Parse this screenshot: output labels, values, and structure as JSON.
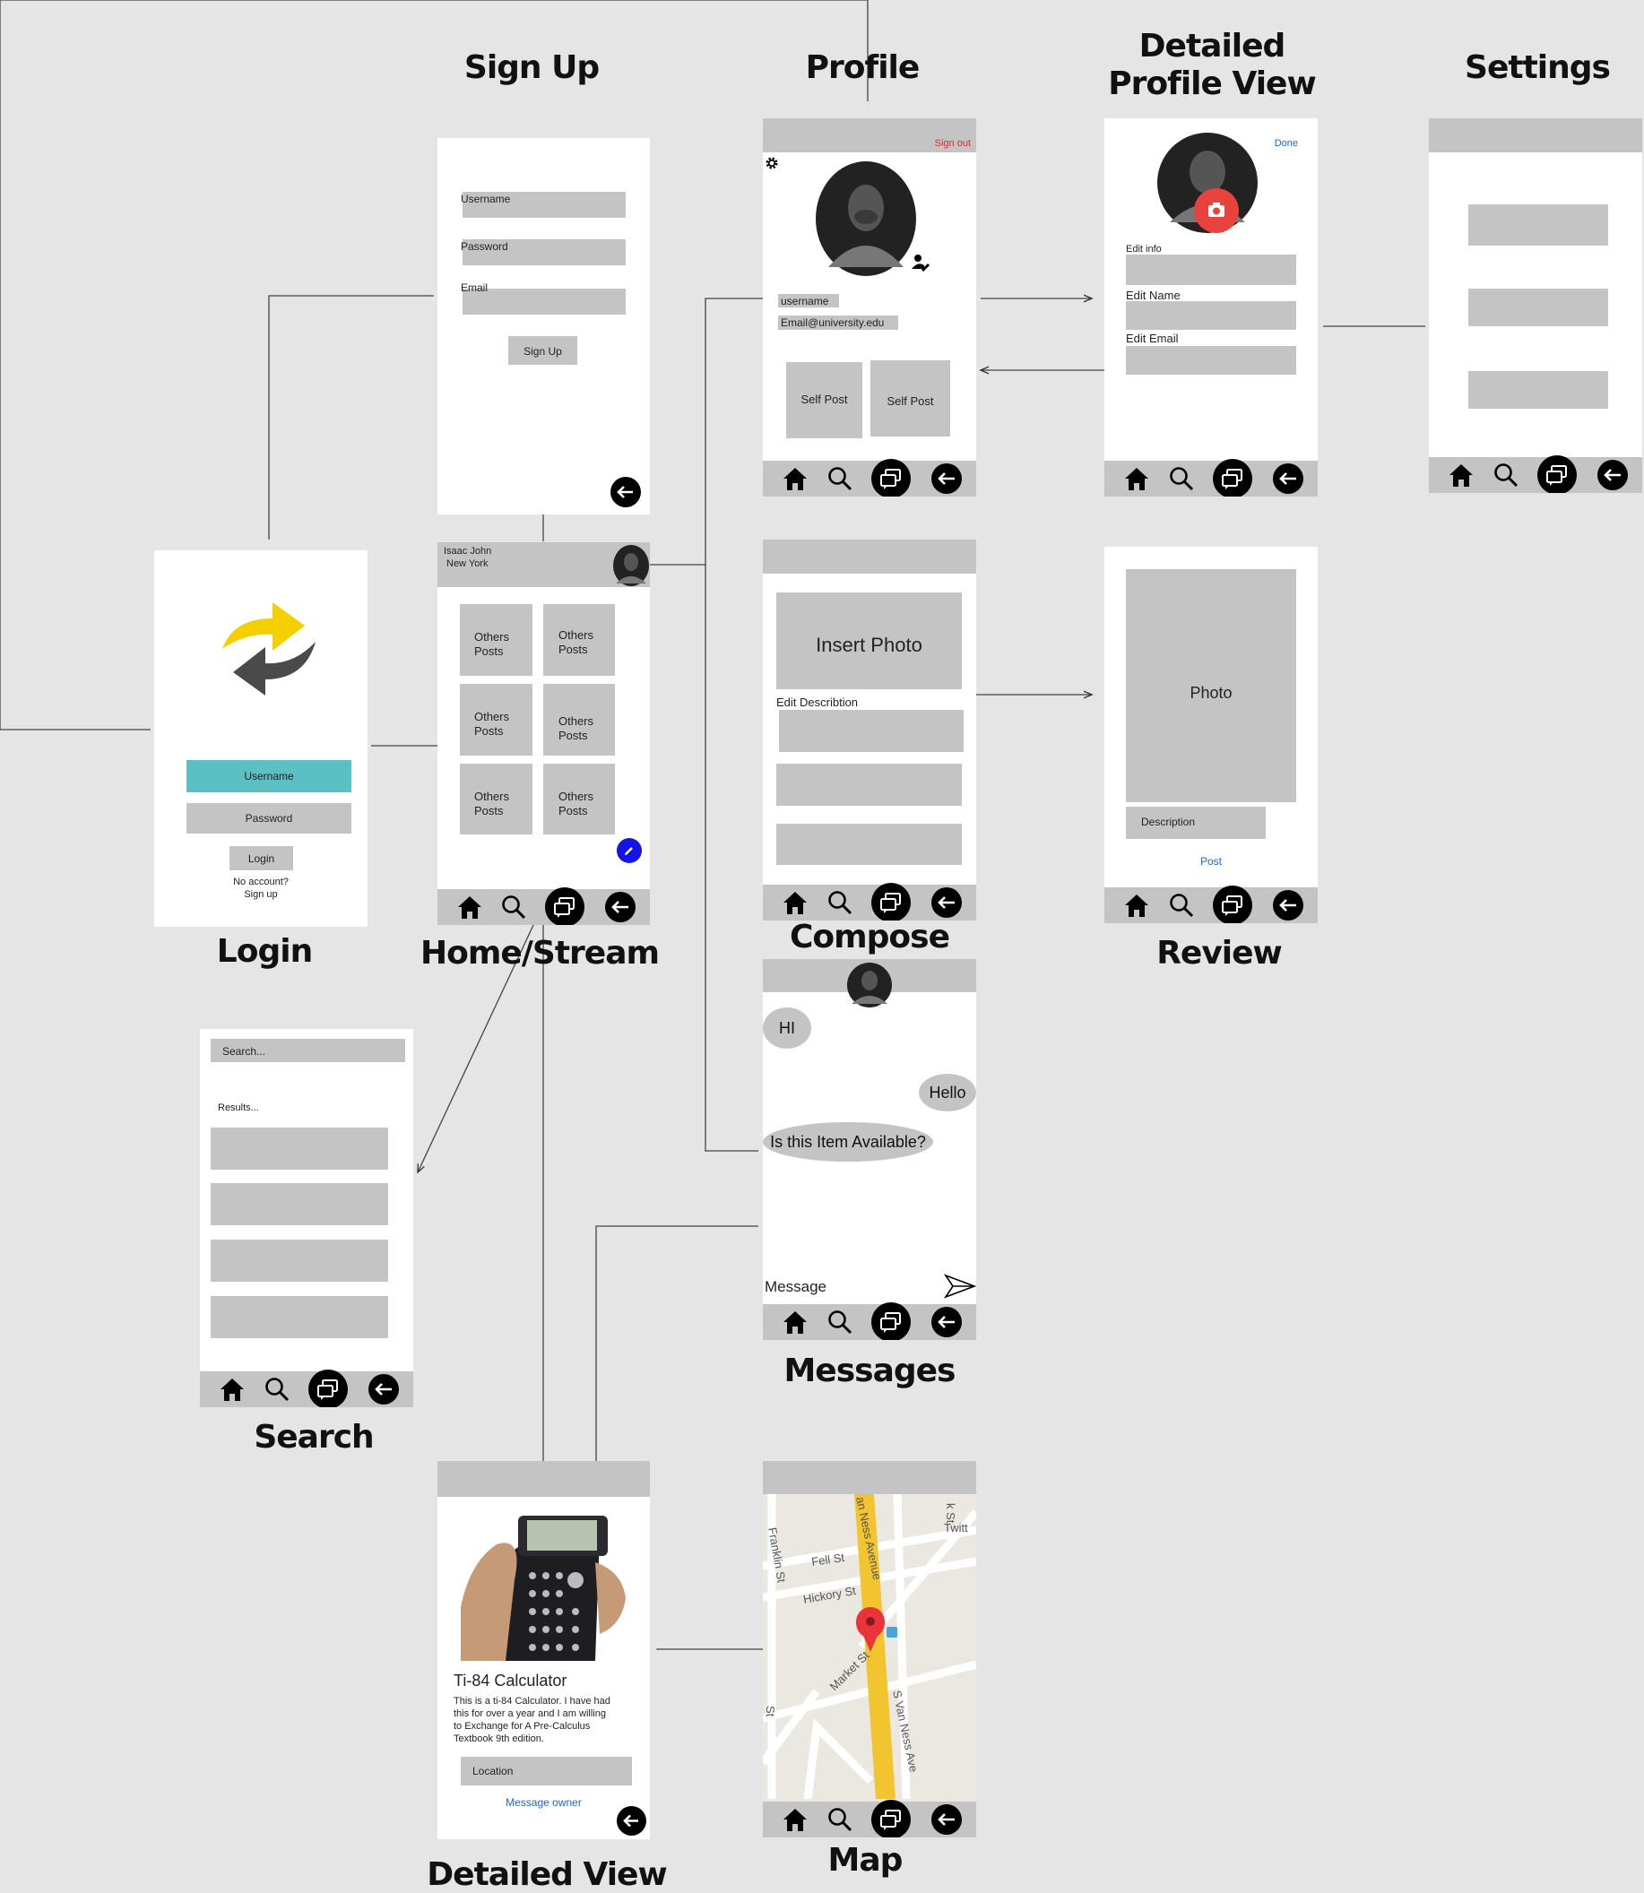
{
  "titles": {
    "sign_up": "Sign Up",
    "profile": "Profile",
    "detailed_profile_view_line1": "Detailed",
    "detailed_profile_view_line2": "Profile View",
    "settings": "Settings",
    "login": "Login",
    "home_stream": "Home/Stream",
    "compose": "Compose",
    "review": "Review",
    "messages": "Messages",
    "search": "Search",
    "detailed_view": "Detailed View",
    "map": "Map"
  },
  "signup": {
    "username_label": "Username",
    "password_label": "Password",
    "email_label": "Email",
    "button": "Sign Up"
  },
  "profile": {
    "sign_out": "Sign out",
    "username": "username",
    "email": "Email@university.edu",
    "posts": [
      "Self Post",
      "Self Post"
    ]
  },
  "detailed_profile": {
    "done": "Done",
    "edit_info": "Edit info",
    "edit_name": "Edit Name",
    "edit_email": "Edit Email"
  },
  "login": {
    "username": "Username",
    "password": "Password",
    "button": "Login",
    "no_account": "No account?",
    "sign_up": "Sign up",
    "colors": {
      "accent": "#5bbfc4",
      "logo_yellow": "#f5d000",
      "logo_dark": "#4a4a4d"
    }
  },
  "home": {
    "user_name": "Isaac John",
    "user_location": "New York",
    "tiles": [
      [
        "Others",
        "Posts"
      ],
      [
        "Others",
        "Posts"
      ],
      [
        "Others",
        "Posts"
      ],
      [
        "Others",
        "Posts"
      ],
      [
        "Others",
        "Posts"
      ],
      [
        "Others",
        "Posts"
      ]
    ]
  },
  "compose": {
    "insert_photo": "Insert Photo",
    "edit_description": "Edit Describtion"
  },
  "review": {
    "photo": "Photo",
    "description": "Description",
    "post": "Post"
  },
  "messages": {
    "bubbles": [
      "HI",
      "Hello",
      "Is this Item Available?"
    ],
    "message_placeholder": "Message"
  },
  "search": {
    "search_placeholder": "Search...",
    "results": "Results..."
  },
  "detailed_view": {
    "item_title": "Ti-84 Calculator",
    "description": [
      "This is a ti-84 Calculator. I have had",
      "this for over a year and I am willing",
      "to Exchange for A Pre-Calculus",
      "Textbook 9th edition."
    ],
    "location": "Location",
    "message_owner": "Message owner"
  },
  "map": {
    "streets": [
      "an Ness Avenue",
      "k St",
      "Twitt",
      "Franklin St",
      "Fell St",
      "Hickory St",
      "Market St",
      "S Van Ness Ave",
      "St"
    ]
  },
  "icons": {
    "home": "home-icon",
    "search": "search-icon",
    "messages": "chat-bubbles-icon",
    "back": "back-arrow-icon",
    "gear": "gear-icon",
    "edit_person": "edit-person-icon",
    "camera": "camera-icon",
    "pencil": "pencil-icon",
    "send": "send-icon",
    "map_pin": "map-pin-icon"
  }
}
